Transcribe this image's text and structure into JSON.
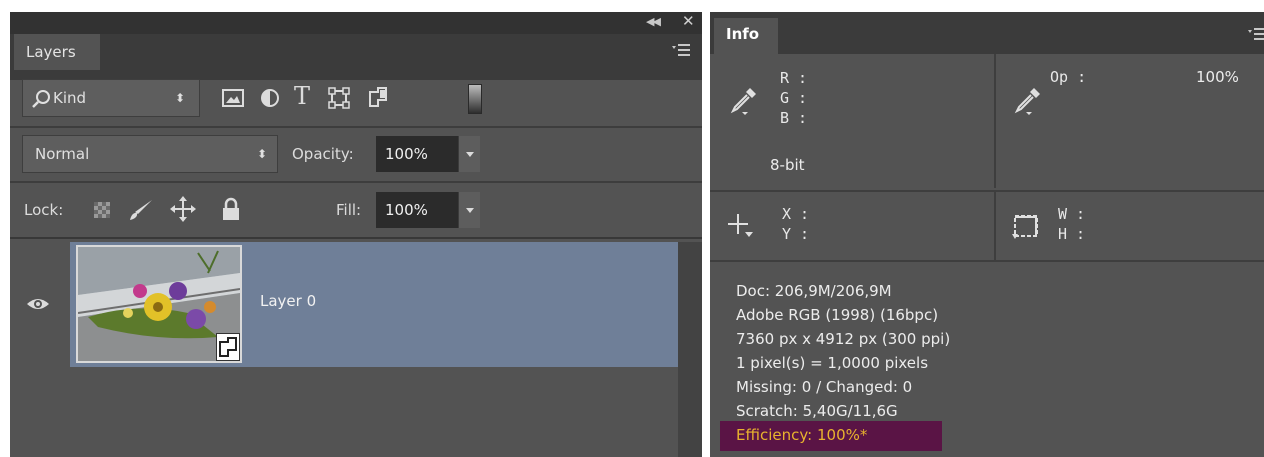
{
  "layers_panel": {
    "tab_label": "Layers",
    "collapse_icon": "double-chevron-left",
    "close_icon": "close-x",
    "menu_icon": "panel-menu",
    "filter": {
      "search_icon": "magnifier",
      "kind_label": "Kind",
      "filter_icons": [
        "pixel-layer-filter",
        "adjustment-layer-filter",
        "type-layer-filter",
        "shape-layer-filter",
        "smart-object-filter",
        "filter-toggle"
      ]
    },
    "blend_mode": "Normal",
    "opacity_label": "Opacity:",
    "opacity_value": "100%",
    "lock_label": "Lock:",
    "lock_icons": [
      "lock-transparent-pixels",
      "lock-image-pixels",
      "lock-position",
      "lock-all"
    ],
    "fill_label": "Fill:",
    "fill_value": "100%",
    "layers": [
      {
        "name": "Layer 0",
        "visible": true,
        "selected": true,
        "smart_object": true,
        "thumbnail": "flowers-on-wooden-step"
      }
    ],
    "selected_color": "#6f7f98"
  },
  "info_panel": {
    "tab_label": "Info",
    "menu_icon": "panel-menu",
    "color_readout": {
      "channels": [
        "R :",
        "G :",
        "B :"
      ],
      "bit_depth": "8-bit"
    },
    "opacity_readout": {
      "label": "Op :",
      "value": "100%"
    },
    "position_readout": {
      "channels": [
        "X :",
        "Y :"
      ]
    },
    "size_readout": {
      "channels": [
        "W :",
        "H :"
      ]
    },
    "doc_info": [
      "Doc: 206,9M/206,9M",
      "Adobe RGB (1998) (16bpc)",
      "7360 px x 4912 px (300 ppi)",
      "1 pixel(s) = 1,0000 pixels",
      "Missing: 0 / Changed: 0",
      "Scratch: 5,40G/11,6G"
    ],
    "efficiency": "Efficiency: 100%*",
    "efficiency_highlight": "#5a1445",
    "efficiency_text_color": "#e8b32e"
  }
}
